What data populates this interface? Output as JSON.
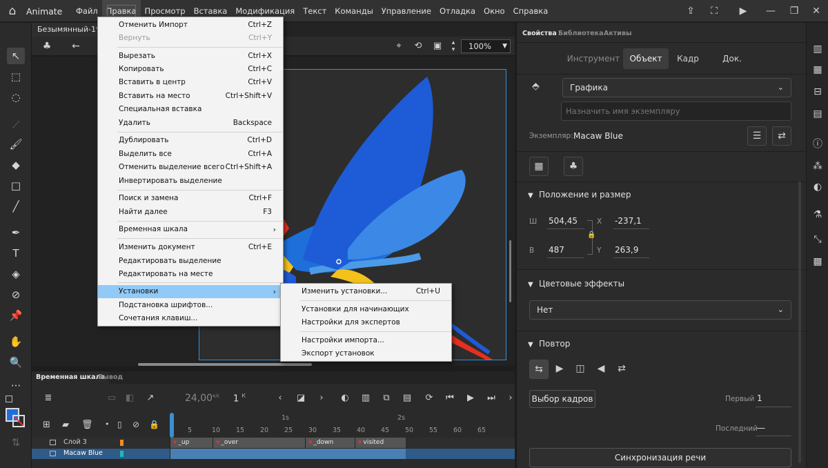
{
  "app": {
    "name": "Animate"
  },
  "menubar": [
    {
      "label": "Файл"
    },
    {
      "label": "Правка",
      "active": true
    },
    {
      "label": "Просмотр"
    },
    {
      "label": "Вставка"
    },
    {
      "label": "Модификация"
    },
    {
      "label": "Текст"
    },
    {
      "label": "Команды"
    },
    {
      "label": "Управление"
    },
    {
      "label": "Отладка"
    },
    {
      "label": "Окно"
    },
    {
      "label": "Справка"
    }
  ],
  "document": {
    "tab_title": "Безымянный-1*",
    "close": "×",
    "zoom": "100%"
  },
  "edit_menu": {
    "undo": {
      "label": "Отменить Импорт",
      "shortcut": "Ctrl+Z"
    },
    "redo": {
      "label": "Вернуть",
      "shortcut": "Ctrl+Y"
    },
    "cut": {
      "label": "Вырезать",
      "shortcut": "Ctrl+X"
    },
    "copy": {
      "label": "Копировать",
      "shortcut": "Ctrl+C"
    },
    "paste_center": {
      "label": "Вставить в центр",
      "shortcut": "Ctrl+V"
    },
    "paste_in_place": {
      "label": "Вставить на место",
      "shortcut": "Ctrl+Shift+V"
    },
    "paste_special": {
      "label": "Специальная вставка"
    },
    "delete": {
      "label": "Удалить",
      "shortcut": "Backspace"
    },
    "duplicate": {
      "label": "Дублировать",
      "shortcut": "Ctrl+D"
    },
    "select_all": {
      "label": "Выделить все",
      "shortcut": "Ctrl+A"
    },
    "deselect_all": {
      "label": "Отменить выделение всего",
      "shortcut": "Ctrl+Shift+A"
    },
    "invert_selection": {
      "label": "Инвертировать выделение"
    },
    "find_replace": {
      "label": "Поиск и замена",
      "shortcut": "Ctrl+F"
    },
    "find_next": {
      "label": "Найти далее",
      "shortcut": "F3"
    },
    "timeline": {
      "label": "Временная шкала"
    },
    "edit_document": {
      "label": "Изменить документ",
      "shortcut": "Ctrl+E"
    },
    "edit_selected": {
      "label": "Редактировать выделение"
    },
    "edit_in_place": {
      "label": "Редактировать на месте"
    },
    "preferences": {
      "label": "Установки"
    },
    "font_mapping": {
      "label": "Подстановка шрифтов..."
    },
    "shortcuts": {
      "label": "Сочетания клавиш..."
    }
  },
  "preferences_submenu": {
    "edit": {
      "label": "Изменить установки...",
      "shortcut": "Ctrl+U"
    },
    "beginner": {
      "label": "Установки для начинающих"
    },
    "expert": {
      "label": "Настройки для экспертов"
    },
    "import": {
      "label": "Настройки импорта..."
    },
    "export": {
      "label": "Экспорт установок"
    }
  },
  "timeline": {
    "tab_timeline": "Временная шкала",
    "tab_output": "Вывод",
    "fps": "24,00",
    "fps_unit": "к/с",
    "current_frame": "1",
    "frame_unit": "К",
    "ruler_labels": [
      "1s",
      "2s"
    ],
    "ticks": [
      "5",
      "10",
      "15",
      "20",
      "25",
      "30",
      "35",
      "40",
      "45",
      "50",
      "55",
      "60",
      "65"
    ],
    "layers": [
      {
        "name": "Слой 3",
        "color": "#f08c1e",
        "labels": [
          "_up",
          "_over",
          "_down",
          "visited"
        ]
      },
      {
        "name": "Macaw Blue",
        "color": "#1fb8b8",
        "selected": true
      }
    ]
  },
  "properties": {
    "tabs": [
      "Свойства",
      "Библиотека",
      "Активы"
    ],
    "subtabs": [
      "Инструмент",
      "Объект",
      "Кадр",
      "Док."
    ],
    "active_subtab": "Объект",
    "symbol_type": "Графика",
    "instance_name_placeholder": "Назначить имя экземпляру",
    "instance_label": "Экземпляр:",
    "instance_name": "Macaw Blue",
    "position_size": {
      "title": "Положение и размер",
      "w_label": "Ш",
      "w": "504,45",
      "h_label": "В",
      "h": "487",
      "x_label": "X",
      "x": "-237,1",
      "y_label": "Y",
      "y": "263,9"
    },
    "color_effects": {
      "title": "Цветовые эффекты",
      "value": "Нет"
    },
    "looping": {
      "title": "Повтор",
      "choose_frame": "Выбор кадров",
      "first_label": "Первый",
      "first": "1",
      "last_label": "Последний",
      "last": "—"
    },
    "lip_sync": "Синхронизация речи"
  },
  "colors": {
    "stroke": "#1f1f1f",
    "fill": "#1e6fd9",
    "accent_blue": "#3a8fd1",
    "menu_highlight": "#91c9f7"
  }
}
